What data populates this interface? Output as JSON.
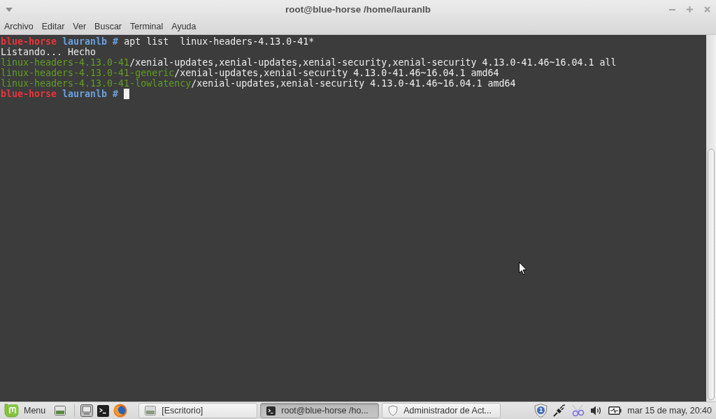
{
  "window": {
    "title": "root@blue-horse /home/lauranlb"
  },
  "menu_bar": [
    {
      "label": "Archivo"
    },
    {
      "label": "Editar"
    },
    {
      "label": "Ver"
    },
    {
      "label": "Buscar"
    },
    {
      "label": "Terminal"
    },
    {
      "label": "Ayuda"
    }
  ],
  "terminal": {
    "lines": [
      {
        "cursor": false,
        "segments": [
          {
            "kind": "host",
            "text": "blue-horse"
          },
          {
            "kind": "user",
            "text": " lauranlb #"
          },
          {
            "kind": "text",
            "text": " apt list  linux-headers-4.13.0-41*"
          }
        ]
      },
      {
        "cursor": false,
        "segments": [
          {
            "kind": "text",
            "text": "Listando... Hecho"
          }
        ]
      },
      {
        "cursor": false,
        "segments": [
          {
            "kind": "package",
            "text": "linux-headers-4.13.0-41"
          },
          {
            "kind": "text",
            "text": "/xenial-updates,xenial-updates,xenial-security,xenial-security 4.13.0-41.46~16.04.1 all"
          }
        ]
      },
      {
        "cursor": false,
        "segments": [
          {
            "kind": "package",
            "text": "linux-headers-4.13.0-41-generic"
          },
          {
            "kind": "text",
            "text": "/xenial-updates,xenial-security 4.13.0-41.46~16.04.1 amd64"
          }
        ]
      },
      {
        "cursor": false,
        "segments": [
          {
            "kind": "package",
            "text": "linux-headers-4.13.0-41-lowlatency"
          },
          {
            "kind": "text",
            "text": "/xenial-updates,xenial-security 4.13.0-41.46~16.04.1 amd64"
          }
        ]
      },
      {
        "cursor": true,
        "segments": [
          {
            "kind": "host",
            "text": "blue-horse"
          },
          {
            "kind": "user",
            "text": " lauranlb # "
          }
        ]
      }
    ]
  },
  "taskbar": {
    "menu_label": "Menu",
    "windows": [
      {
        "kind": "desktop",
        "label": "[Escritorio]",
        "selected": false
      },
      {
        "kind": "terminal",
        "label": "root@blue-horse /ho...",
        "selected": true
      },
      {
        "kind": "shield",
        "label": "Administrador de Act...",
        "selected": false
      }
    ],
    "update_count": "1",
    "clock": "mar 15 de may, 20:40"
  }
}
